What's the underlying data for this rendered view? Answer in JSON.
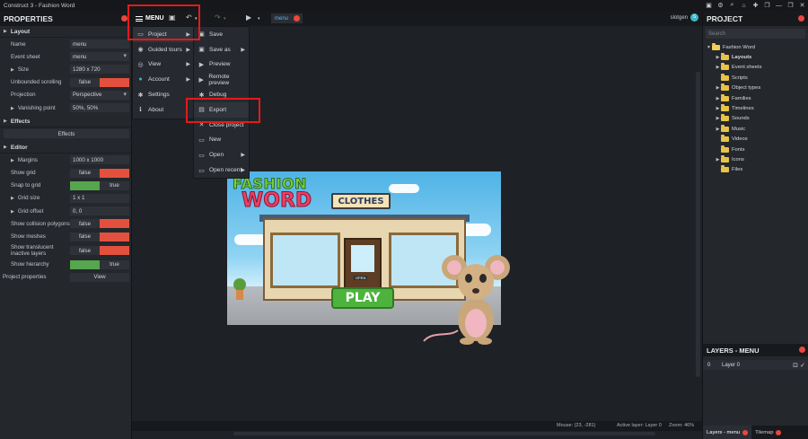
{
  "window": {
    "title": "Construct 3 - Fashion Word",
    "buttons": [
      "▣",
      "⚙",
      "⌕",
      "⌂",
      "✚",
      "❐",
      "—",
      "❐",
      "✕"
    ]
  },
  "properties": {
    "header": "PROPERTIES",
    "sections": {
      "layout": "Layout",
      "effects": "Effects",
      "editor": "Editor"
    },
    "layout_rows": {
      "name_label": "Name",
      "name_value": "menu",
      "event_sheet_label": "Event sheet",
      "event_sheet_value": "menu",
      "size_label": "Size",
      "size_value": "1280 x 720",
      "unbounded_label": "Unbounded scrolling",
      "unbounded_value": "false",
      "projection_label": "Projection",
      "projection_value": "Perspective",
      "vanishing_label": "Vanishing point",
      "vanishing_value": "50%, 50%"
    },
    "effects_button": "Effects",
    "editor_rows": {
      "margins_label": "Margins",
      "margins_value": "1000 x 1000",
      "show_grid_label": "Show grid",
      "show_grid_value": "false",
      "snap_grid_label": "Snap to grid",
      "snap_grid_value": "true",
      "grid_size_label": "Grid size",
      "grid_size_value": "1 x 1",
      "grid_offset_label": "Grid offset",
      "grid_offset_value": "0, 0",
      "collision_label": "Show collision polygons",
      "collision_value": "false",
      "meshes_label": "Show meshes",
      "meshes_value": "false",
      "translucent_label": "Show translucent inactive layers",
      "translucent_value": "false",
      "hierarchy_label": "Show hierarchy",
      "hierarchy_value": "true"
    },
    "project_props_label": "Project properties",
    "project_props_button": "View"
  },
  "toolbar": {
    "menu_label": "MENU",
    "layout_tab": "menu",
    "user": "slotgen",
    "user_avatar": "S"
  },
  "main_menu": [
    {
      "label": "Project",
      "icon": "▭"
    },
    {
      "label": "Guided tours",
      "icon": "◉"
    },
    {
      "label": "View",
      "icon": "◎"
    },
    {
      "label": "Account",
      "icon": "●"
    },
    {
      "label": "Settings",
      "icon": "✱"
    },
    {
      "label": "About",
      "icon": "ℹ"
    }
  ],
  "project_menu": [
    {
      "label": "Save",
      "icon": "▣"
    },
    {
      "label": "Save as",
      "icon": "▣"
    },
    {
      "label": "Preview",
      "icon": "▶"
    },
    {
      "label": "Remote preview",
      "icon": "▶"
    },
    {
      "label": "Debug",
      "icon": "✱"
    },
    {
      "label": "Export",
      "icon": "▤"
    },
    {
      "label": "Close project",
      "icon": "✕"
    },
    {
      "label": "New",
      "icon": "▭"
    },
    {
      "label": "Open",
      "icon": "▭"
    },
    {
      "label": "Open recent",
      "icon": "▭"
    }
  ],
  "scene": {
    "logo_line1": "FASHION",
    "logo_line2": "WORD",
    "sign": "CLOTHES",
    "play": "PLAY",
    "door_sign": "OPEN"
  },
  "status": {
    "mouse": "Mouse: (23, -281)",
    "active_layer": "Active layer: Layer 0",
    "zoom": "Zoom: 46%"
  },
  "project_panel": {
    "header": "PROJECT",
    "search_placeholder": "Search",
    "root": "Fashion Word",
    "items": [
      "Layouts",
      "Event sheets",
      "Scripts",
      "Object types",
      "Families",
      "Timelines",
      "Sounds",
      "Music",
      "Videos",
      "Fonts",
      "Icons",
      "Files"
    ]
  },
  "layers_panel": {
    "header": "LAYERS - MENU",
    "layer_index": "0",
    "layer_name": "Layer 0"
  },
  "bottom_tabs": {
    "layers": "Layers - menu",
    "tilemap": "Tilemap"
  },
  "colors": {
    "accent_red": "#e8483c",
    "highlight": "#e21b1b",
    "toggle_true": "#55a64c",
    "toggle_false": "#e3513e"
  }
}
